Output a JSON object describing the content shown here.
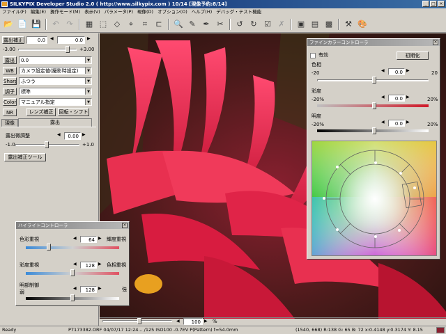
{
  "window": {
    "title": "SILKYPIX Developer Studio 2.0 ( http://www.silkypix.com )  10/14 [現像予約:8/14]"
  },
  "menu": [
    "ファイル(F)",
    "編集(E)",
    "操作モード(M)",
    "表示(V)",
    "パラメータ(P)",
    "現像(D)",
    "オプション(O)",
    "ヘルプ(H)",
    "デバッグ・テスト機能"
  ],
  "left": {
    "exposure_comp_label": "露出補正",
    "exposure_comp_value": "0.0",
    "exposure_comp_value2": "0.0",
    "exposure_min": "-3.00",
    "exposure_max": "+3.00",
    "rows": [
      {
        "button": "露出",
        "value": "0.0"
      },
      {
        "button": "WB",
        "value": "カメラ設定値(撮影時設定)"
      },
      {
        "button": "Sharp",
        "value": "ふつう"
      },
      {
        "button": "調子",
        "value": "標準"
      },
      {
        "button": "Color",
        "value": "マニュアル指定"
      }
    ],
    "nr": "NR",
    "lens": "レンズ補正",
    "rotate": "回転・シフト",
    "tab_develop": "現像",
    "tab_exposure": "露出",
    "fine_label": "露出微調整",
    "fine_value": "0.00",
    "fine_min": "-1.0",
    "fine_max": "+1.0",
    "tool_button": "露出補正ツール"
  },
  "highlight_panel": {
    "title": "ハイライトコントローラ",
    "row1_label": "色彩重視",
    "row1_value": "64",
    "row1_right": "輝度重視",
    "row2_label": "彩度重視",
    "row2_value": "128",
    "row2_right": "色相重視",
    "row3_label": "明部制御",
    "row3_sub": "弱",
    "row3_value": "128",
    "row3_right": "強",
    "values": {
      "row1": 64,
      "row2": 128,
      "row3": 128
    }
  },
  "fine_color_panel": {
    "title": "ファインカラーコントローラ",
    "enabled_label": "有効",
    "reset_button": "初期化",
    "hue_label": "色相",
    "hue_min": "-20",
    "hue_max": "20",
    "hue_value": "0.0",
    "sat_label": "彩度",
    "sat_min": "-20%",
    "sat_max": "20%",
    "sat_value": "0.0",
    "light_label": "明度",
    "light_min": "-20%",
    "light_max": "20%",
    "light_value": "0.0"
  },
  "zoom": {
    "value": "100",
    "unit": "%"
  },
  "status": {
    "ready": "Ready",
    "file_info": "P7173382.ORF 04/07/17 12:24... /125 ISO100 -0.7EV P(Pattern) f=54.0mm",
    "pixel_info": "(1540, 668) R:138 G: 65 B: 72 x:0.4148 y:0.3174 Y: 8.15"
  },
  "colors": {
    "accent": "#0a246a",
    "flower": "#e8264a"
  }
}
